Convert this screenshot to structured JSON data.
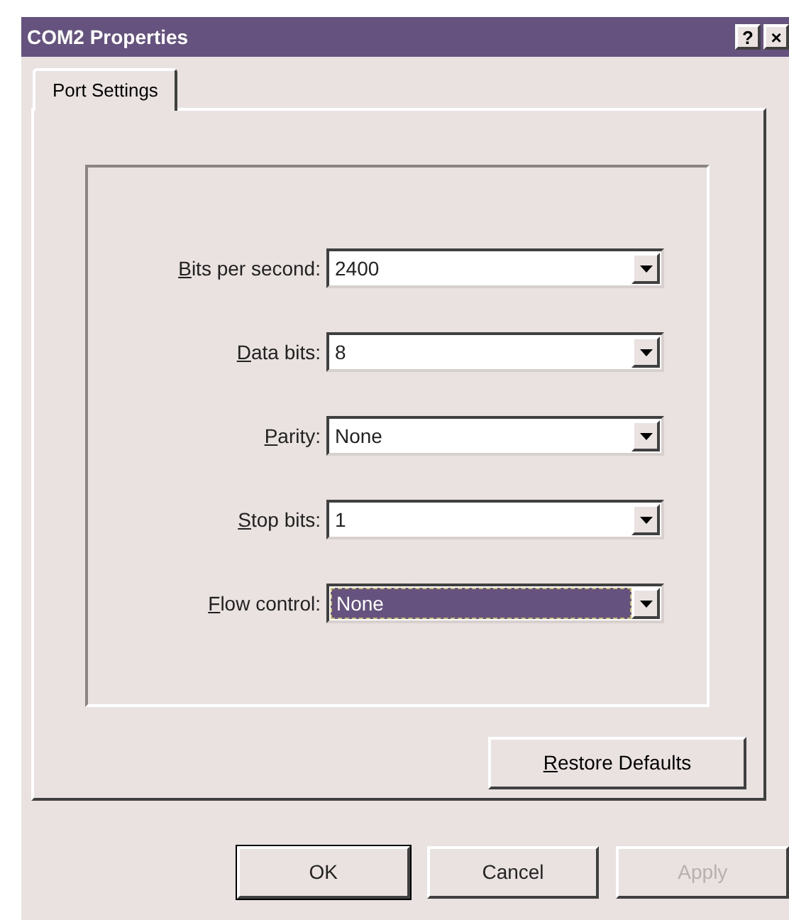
{
  "window": {
    "title": "COM2 Properties",
    "controls": [
      "?",
      "×"
    ]
  },
  "tabs": [
    {
      "label": "Port Settings",
      "selected": true
    }
  ],
  "fields": [
    {
      "accel": "B",
      "label": "its per second:",
      "value": "2400",
      "focused": false
    },
    {
      "accel": "D",
      "label": "ata bits:",
      "value": "8",
      "focused": false
    },
    {
      "accel": "P",
      "label": "arity:",
      "value": "None",
      "focused": false
    },
    {
      "accel": "S",
      "label": "top bits:",
      "value": "1",
      "focused": false
    },
    {
      "accel": "F",
      "label": "low control:",
      "value": "None",
      "focused": true
    }
  ],
  "restore_button": {
    "accel": "R",
    "label": "estore Defaults"
  },
  "buttons": [
    {
      "label": "OK",
      "default": true,
      "disabled": false
    },
    {
      "label": "Cancel",
      "default": false,
      "disabled": false
    },
    {
      "label": "Apply",
      "default": false,
      "disabled": true
    }
  ]
}
